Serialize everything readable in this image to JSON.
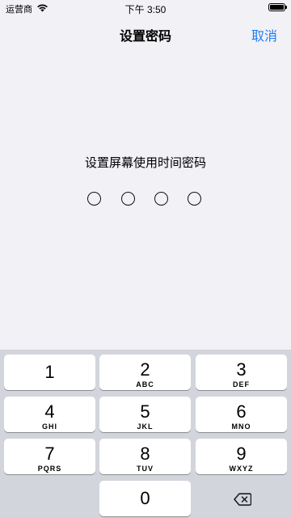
{
  "status_bar": {
    "carrier": "运营商",
    "time": "下午 3:50"
  },
  "nav": {
    "title": "设置密码",
    "cancel_label": "取消"
  },
  "prompt": "设置屏幕使用时间密码",
  "passcode": {
    "length": 4,
    "filled": 0
  },
  "keypad": {
    "keys": [
      {
        "digit": "1",
        "letters": ""
      },
      {
        "digit": "2",
        "letters": "ABC"
      },
      {
        "digit": "3",
        "letters": "DEF"
      },
      {
        "digit": "4",
        "letters": "GHI"
      },
      {
        "digit": "5",
        "letters": "JKL"
      },
      {
        "digit": "6",
        "letters": "MNO"
      },
      {
        "digit": "7",
        "letters": "PQRS"
      },
      {
        "digit": "8",
        "letters": "TUV"
      },
      {
        "digit": "9",
        "letters": "WXYZ"
      },
      {
        "digit": "0",
        "letters": ""
      }
    ],
    "backspace_icon": "delete-backward-icon"
  },
  "colors": {
    "accent": "#1e7cf6",
    "background": "#f1f1f6",
    "keypad_background": "#d2d5db"
  }
}
